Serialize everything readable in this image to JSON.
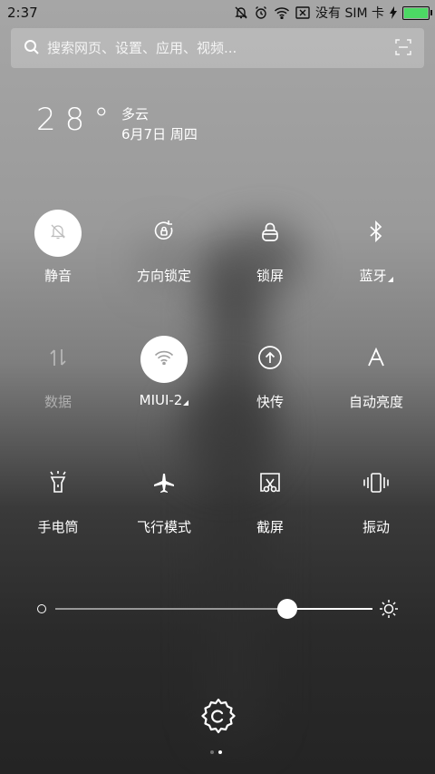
{
  "status_bar": {
    "time": "2:37",
    "carrier": "没有 SIM 卡",
    "battery_level": 1.0,
    "battery_color": "#4cd964",
    "icons": [
      "bell-off-icon",
      "alarm-icon",
      "wifi-icon",
      "nfc-icon",
      "charging-icon",
      "battery-icon"
    ]
  },
  "search": {
    "placeholder": "搜索网页、设置、应用、视频..."
  },
  "weather": {
    "temperature": "28°",
    "condition": "多云",
    "date": "6月7日 周四"
  },
  "toggles": [
    {
      "label": "静音",
      "icon": "bell-off-icon",
      "active": true
    },
    {
      "label": "方向锁定",
      "icon": "rotation-lock-icon",
      "active": false
    },
    {
      "label": "锁屏",
      "icon": "lock-icon",
      "active": false
    },
    {
      "label": "蓝牙",
      "icon": "bluetooth-icon",
      "active": false,
      "has_submenu": true
    },
    {
      "label": "数据",
      "icon": "data-icon",
      "active": false,
      "disabled": true
    },
    {
      "label": "MIUI-2",
      "icon": "wifi-icon",
      "active": true,
      "has_submenu": true
    },
    {
      "label": "快传",
      "icon": "share-icon",
      "active": false
    },
    {
      "label": "自动亮度",
      "icon": "auto-brightness-icon",
      "active": false
    },
    {
      "label": "手电筒",
      "icon": "flashlight-icon",
      "active": false
    },
    {
      "label": "飞行模式",
      "icon": "airplane-icon",
      "active": false
    },
    {
      "label": "截屏",
      "icon": "screenshot-icon",
      "active": false
    },
    {
      "label": "振动",
      "icon": "vibrate-icon",
      "active": false
    }
  ],
  "brightness": {
    "level": 0.73
  },
  "pager": {
    "pages": 2,
    "current": 2
  }
}
